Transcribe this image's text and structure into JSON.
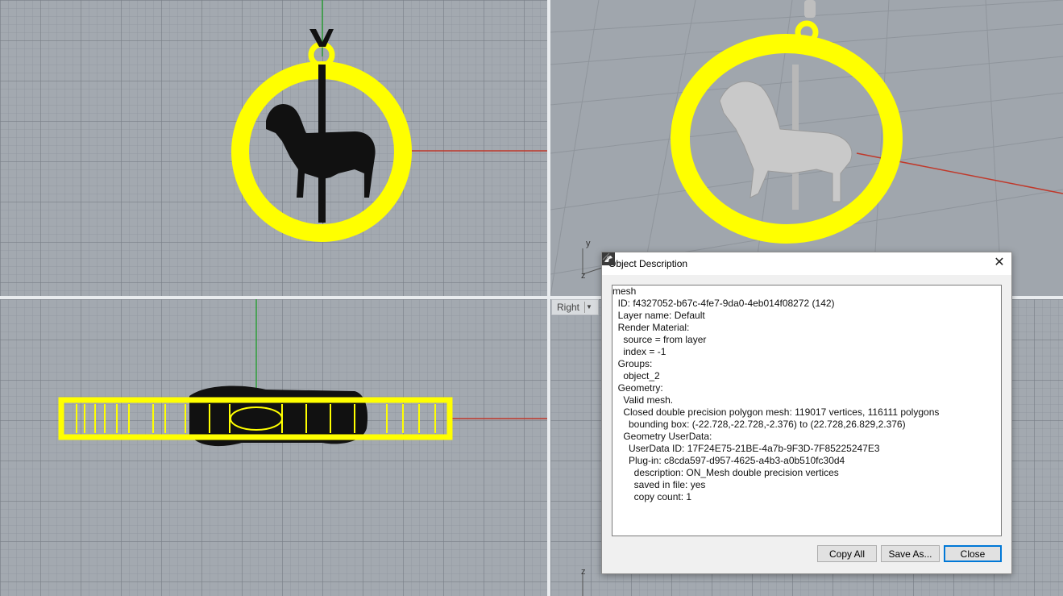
{
  "viewports": {
    "right_label": "Right"
  },
  "axes": {
    "persp_y": "y",
    "persp_z": "z",
    "right_z": "z"
  },
  "dialog": {
    "title": "Object Description",
    "close_glyph": "✕",
    "lines": [
      "mesh",
      "  ID: f4327052-b67c-4fe7-9da0-4eb014f08272 (142)",
      "  Layer name: Default",
      "  Render Material:",
      "    source = from layer",
      "    index = -1",
      "  Groups:",
      "    object_2",
      "  Geometry:",
      "    Valid mesh.",
      "    Closed double precision polygon mesh: 119017 vertices, 116111 polygons",
      "      bounding box: (-22.728,-22.728,-2.376) to (22.728,26.829,2.376)",
      "    Geometry UserData:",
      "      UserData ID: 17F24E75-21BE-4a7b-9F3D-7F85225247E3",
      "      Plug-in: c8cda597-d957-4625-a4b3-a0b510fc30d4",
      "        description: ON_Mesh double precision vertices",
      "        saved in file: yes",
      "        copy count: 1"
    ],
    "buttons": {
      "copy_all": "Copy All",
      "save_as": "Save As...",
      "close": "Close"
    }
  },
  "colors": {
    "selection": "#ffff00",
    "x_axis": "#c0392b",
    "y_axis": "#2e9e3a"
  }
}
